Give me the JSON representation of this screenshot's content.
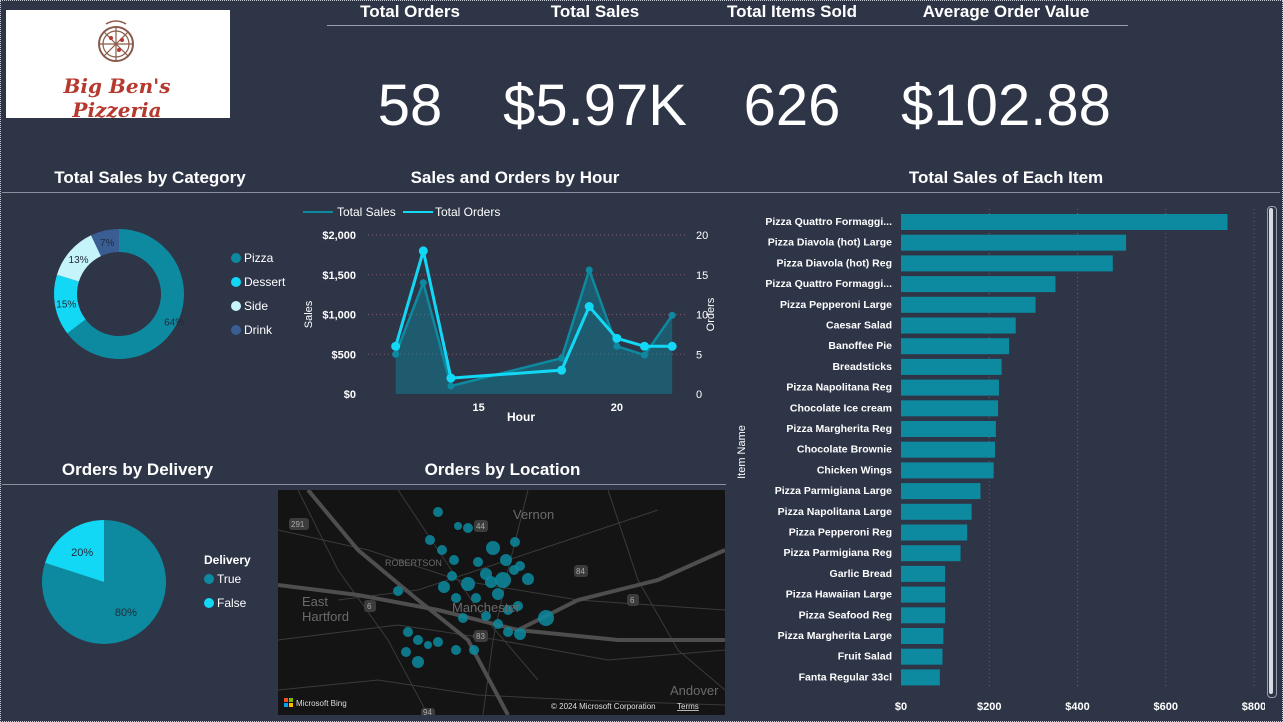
{
  "brand": {
    "name": "Big Ben's Pizzeria"
  },
  "kpis": [
    {
      "title": "Total Orders",
      "value": "58"
    },
    {
      "title": "Total Sales",
      "value": "$5.97K"
    },
    {
      "title": "Total Items Sold",
      "value": "626"
    },
    {
      "title": "Average Order Value",
      "value": "$102.88"
    }
  ],
  "colors": {
    "primary": "#0d8aa0",
    "cyan": "#13d8f5",
    "light": "#c6f4fb",
    "navy": "#3a5e94",
    "background": "#2e3547"
  },
  "chart_data": [
    {
      "id": "category",
      "type": "pie",
      "title": "Total Sales by Category",
      "labels": [
        "Pizza",
        "Dessert",
        "Side",
        "Drink"
      ],
      "values": [
        64,
        15,
        13,
        7
      ],
      "value_labels": [
        "64%",
        "15%",
        "13%",
        "7%"
      ],
      "colors": [
        "#0d8aa0",
        "#13d8f5",
        "#c6f4fb",
        "#3a5e94"
      ],
      "donut": true,
      "legend": "right"
    },
    {
      "id": "hour",
      "type": "area",
      "title": "Sales and Orders by Hour",
      "xlabel": "Hour",
      "ylabel": "Sales",
      "y2label": "Orders",
      "x_ticks": [
        "15",
        "20"
      ],
      "y_ticks": [
        "$0",
        "$500",
        "$1,000",
        "$1,500",
        "$2,000"
      ],
      "y2_ticks": [
        "0",
        "5",
        "10",
        "15",
        "20"
      ],
      "ylim": [
        0,
        2000
      ],
      "y2lim": [
        0,
        20
      ],
      "xlim": [
        11,
        22.5
      ],
      "x": [
        12,
        13,
        14,
        18,
        19,
        20,
        21,
        22
      ],
      "series": [
        {
          "name": "Total Sales",
          "values": [
            500,
            1400,
            100,
            450,
            1560,
            600,
            490,
            990
          ]
        },
        {
          "name": "Total Orders",
          "values": [
            6,
            18,
            2,
            3,
            11,
            7,
            6,
            6
          ]
        }
      ],
      "legend": "top-left",
      "grid": true
    },
    {
      "id": "delivery",
      "type": "pie",
      "title": "Orders by Delivery",
      "legend_title": "Delivery",
      "labels": [
        "True",
        "False"
      ],
      "values": [
        80,
        20
      ],
      "value_labels": [
        "80%",
        "20%"
      ],
      "colors": [
        "#0d8aa0",
        "#13d8f5"
      ],
      "legend": "right"
    },
    {
      "id": "items",
      "type": "bar",
      "orientation": "horizontal",
      "title": "Total Sales of Each Item",
      "ylabel": "Item Name",
      "x_ticks": [
        "$0",
        "$200",
        "$400",
        "$600",
        "$800"
      ],
      "xlim": [
        0,
        800
      ],
      "grid": true,
      "categories": [
        "Pizza Quattro Formaggi...",
        "Pizza Diavola (hot) Large",
        "Pizza Diavola (hot) Reg",
        "Pizza Quattro Formaggi...",
        "Pizza Pepperoni Large",
        "Caesar Salad",
        "Banoffee Pie",
        "Breadsticks",
        "Pizza Napolitana Reg",
        "Chocolate Ice cream",
        "Pizza Margherita Reg",
        "Chocolate Brownie",
        "Chicken Wings",
        "Pizza Parmigiana Large",
        "Pizza Napolitana Large",
        "Pizza Pepperoni Reg",
        "Pizza Parmigiana Reg",
        "Garlic Bread",
        "Pizza Hawaiian Large",
        "Pizza Seafood Reg",
        "Pizza Margherita Large",
        "Fruit Salad",
        "Fanta Regular 33cl"
      ],
      "values": [
        740,
        510,
        480,
        350,
        305,
        260,
        245,
        228,
        222,
        220,
        215,
        213,
        210,
        180,
        160,
        150,
        135,
        100,
        100,
        100,
        96,
        94,
        88
      ]
    }
  ],
  "map": {
    "title": "Orders by Location",
    "places": [
      "Vernon",
      "ROBERTSON",
      "East",
      "Hartford",
      "Manchester",
      "Andover"
    ],
    "routes": [
      "291",
      "84",
      "44",
      "6",
      "6",
      "83",
      "94"
    ],
    "attribution": "Microsoft Bing",
    "copyright": "© 2024 Microsoft Corporation",
    "terms": "Terms"
  }
}
